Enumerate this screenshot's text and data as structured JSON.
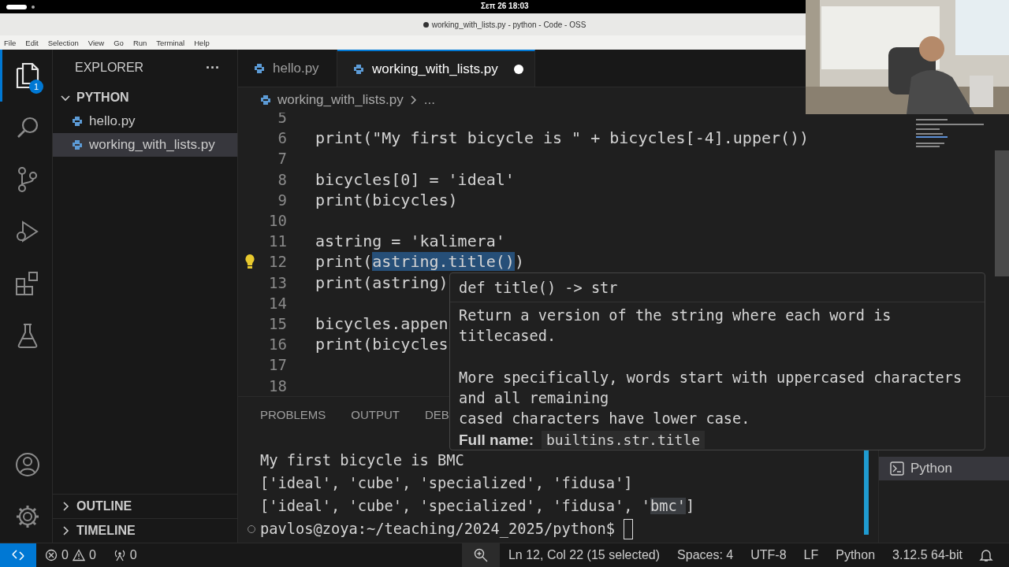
{
  "system_bar": {
    "clock": "Σεπ 26 18:03"
  },
  "window": {
    "title": "working_with_lists.py - python - Code - OSS",
    "modified": true
  },
  "menu": [
    "File",
    "Edit",
    "Selection",
    "View",
    "Go",
    "Run",
    "Terminal",
    "Help"
  ],
  "activity_bar": {
    "top": [
      {
        "kind": "files",
        "selected": true,
        "badge": "1"
      },
      {
        "kind": "search",
        "selected": false
      },
      {
        "kind": "source-control",
        "selected": false
      },
      {
        "kind": "run-debug",
        "selected": false
      },
      {
        "kind": "extensions",
        "selected": false
      },
      {
        "kind": "testing",
        "selected": false
      }
    ],
    "bottom": [
      {
        "kind": "account",
        "selected": false
      },
      {
        "kind": "settings",
        "selected": false
      }
    ]
  },
  "sidebar": {
    "title": "EXPLORER",
    "more": "···",
    "folder": {
      "label": "PYTHON",
      "expanded": true,
      "files": [
        {
          "name": "hello.py",
          "selected": false
        },
        {
          "name": "working_with_lists.py",
          "selected": true
        }
      ]
    },
    "sections": [
      {
        "label": "OUTLINE",
        "expanded": false
      },
      {
        "label": "TIMELINE",
        "expanded": false
      }
    ]
  },
  "tabs": [
    {
      "label": "hello.py",
      "selected": false,
      "modified": false
    },
    {
      "label": "working_with_lists.py",
      "selected": true,
      "modified": true
    }
  ],
  "breadcrumbs": [
    "working_with_lists.py",
    "..."
  ],
  "code_lines": [
    {
      "number": "5"
    },
    {
      "number": "6",
      "text": "print(\"My first bicycle is \" + bicycles[-4].upper())"
    },
    {
      "number": "7"
    },
    {
      "number": "8",
      "text": "bicycles[0] = 'ideal'"
    },
    {
      "number": "9",
      "text": "print(bicycles)"
    },
    {
      "number": "10"
    },
    {
      "number": "11",
      "text": "astring = 'kalimera'"
    },
    {
      "number": "12",
      "lightbulb": true,
      "parts": [
        {
          "text": "print(",
          "selected": false
        },
        {
          "text": "astring.title()",
          "selected": true
        },
        {
          "text": ")",
          "selected": false
        }
      ]
    },
    {
      "number": "13",
      "text": "print(astring)"
    },
    {
      "number": "14"
    },
    {
      "number": "15",
      "text": "bicycles.appen"
    },
    {
      "number": "16",
      "text": "print(bicycles"
    },
    {
      "number": "17"
    },
    {
      "number": "18"
    }
  ],
  "hover": {
    "signature": "def title() -> str",
    "paragraphs": [
      [
        "Return a version of the string where each word is",
        "titlecased."
      ],
      [
        "More specifically, words start with uppercased characters",
        "and all remaining",
        "cased characters have lower case."
      ]
    ],
    "full_name_label": "Full name:",
    "full_name": "builtins.str.title"
  },
  "panel": {
    "tabs": [
      {
        "label": "PROBLEMS",
        "selected": false
      },
      {
        "label": "OUTPUT",
        "selected": false
      },
      {
        "label": "DEB",
        "selected": false
      }
    ],
    "terminal_lines": [
      {
        "kind": "output",
        "parts": [
          {
            "text": "My first bicycle is BMC",
            "selected": false
          }
        ]
      },
      {
        "kind": "output",
        "parts": [
          {
            "text": "['ideal', 'cube', 'specialized', 'fidusa']",
            "selected": false
          }
        ]
      },
      {
        "kind": "output",
        "parts": [
          {
            "text": "['ideal', 'cube', 'specialized', 'fidusa', '",
            "selected": false
          },
          {
            "text": "bmc'",
            "selected": true
          },
          {
            "text": "]",
            "selected": false
          }
        ]
      },
      {
        "kind": "prompt",
        "parts": [
          {
            "text": "pavlos@zoya:~/teaching/2024_2025/python$ ",
            "selected": false
          }
        ]
      }
    ],
    "terminals": [
      {
        "label": "Python",
        "selected": true
      }
    ]
  },
  "status_bar": {
    "errors": "0",
    "warnings": "0",
    "ports": "0",
    "items": [
      "Ln 12, Col 22 (15 selected)",
      "Spaces: 4",
      "UTF-8",
      "LF",
      "Python",
      "3.12.5 64-bit"
    ]
  },
  "webcam": {
    "kind": "picture"
  }
}
